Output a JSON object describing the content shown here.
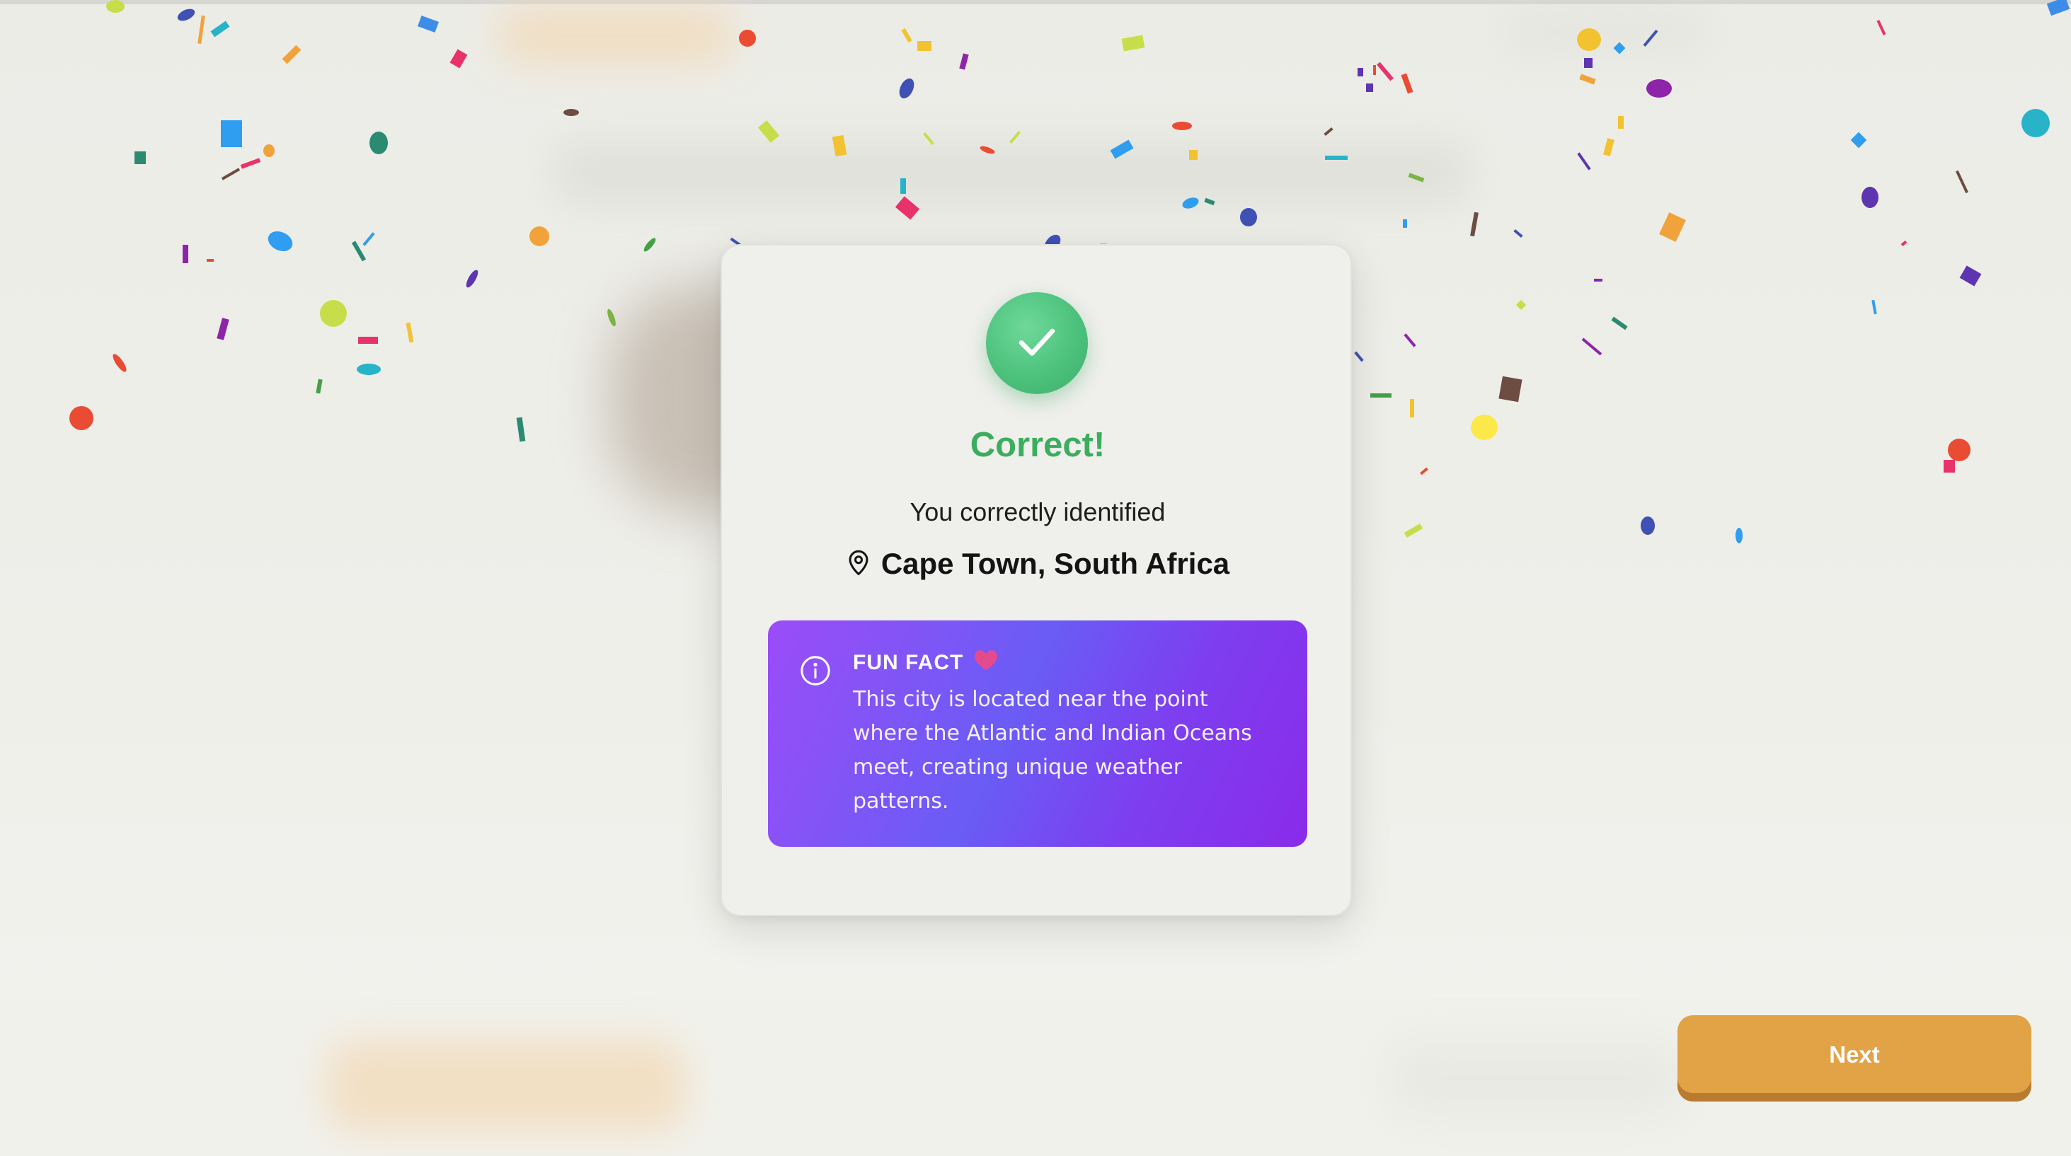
{
  "result": {
    "title": "Correct!",
    "subtitle": "You correctly identified",
    "location": "Cape Town, South Africa"
  },
  "fun_fact": {
    "heading": "FUN FACT",
    "text": "This city is located near the point where the Atlantic and Indian Oceans meet, creating unique weather patterns."
  },
  "buttons": {
    "next_label": "Next"
  },
  "icons": {
    "success": "check-icon",
    "location": "map-pin-icon",
    "info": "info-icon",
    "fact_decoration": "heart-icon"
  },
  "colors": {
    "success_green": "#3cad5f",
    "fact_gradient_start": "#9b4cf8",
    "fact_gradient_mid": "#6a5cf5",
    "fact_gradient_end": "#8a2be9",
    "next_button": "#e2a246",
    "heart": "#e44b8d"
  }
}
